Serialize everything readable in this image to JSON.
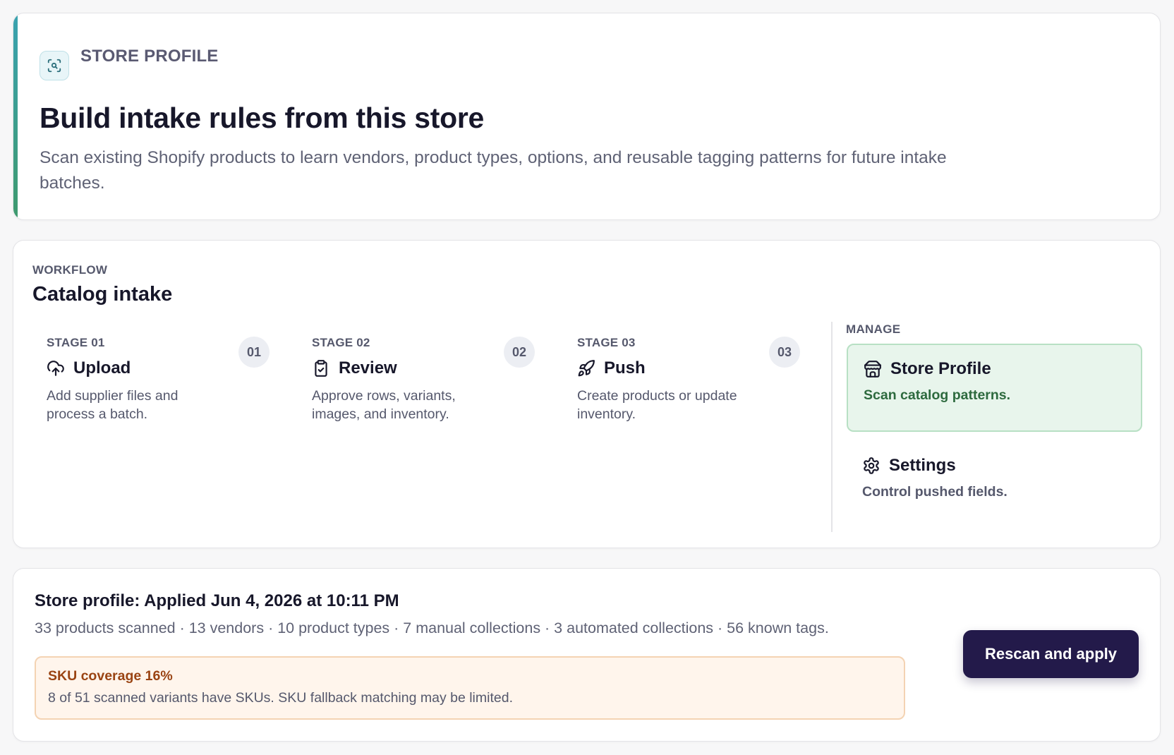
{
  "hero": {
    "eyebrow": "STORE PROFILE",
    "icon": "scan-search-icon",
    "title": "Build intake rules from this store",
    "description": "Scan existing Shopify products to learn vendors, product types, options, and reusable tagging patterns for future intake batches."
  },
  "workflow": {
    "eyebrow": "WORKFLOW",
    "title": "Catalog intake",
    "stages": [
      {
        "label": "STAGE 01",
        "number": "01",
        "title": "Upload",
        "icon": "cloud-upload-icon",
        "description": "Add supplier files and process a batch."
      },
      {
        "label": "STAGE 02",
        "number": "02",
        "title": "Review",
        "icon": "clipboard-check-icon",
        "description": "Approve rows, variants, images, and inventory."
      },
      {
        "label": "STAGE 03",
        "number": "03",
        "title": "Push",
        "icon": "rocket-icon",
        "description": "Create products or update inventory."
      }
    ],
    "manage_label": "MANAGE",
    "manage": [
      {
        "title": "Store Profile",
        "icon": "store-icon",
        "description": "Scan catalog patterns.",
        "active": true
      },
      {
        "title": "Settings",
        "icon": "gear-icon",
        "description": "Control pushed fields.",
        "active": false
      }
    ]
  },
  "status": {
    "title": "Store profile: Applied Jun 4, 2026 at 10:11 PM",
    "summary": "33 products scanned · 13 vendors · 10 product types · 7 manual collections · 3 automated collections · 56 known tags.",
    "warning": {
      "title": "SKU coverage 16%",
      "description": "8 of 51 scanned variants have SKUs. SKU fallback matching may be limited."
    },
    "button_label": "Rescan and apply"
  },
  "colors": {
    "primary_button": "#231a4a",
    "active_nav_bg": "#e8f5ec",
    "warning_bg": "#fff5ec",
    "warning_text": "#9a4413",
    "accent_gradient_start": "#3aa2b0",
    "accent_gradient_end": "#3f9a6e"
  }
}
